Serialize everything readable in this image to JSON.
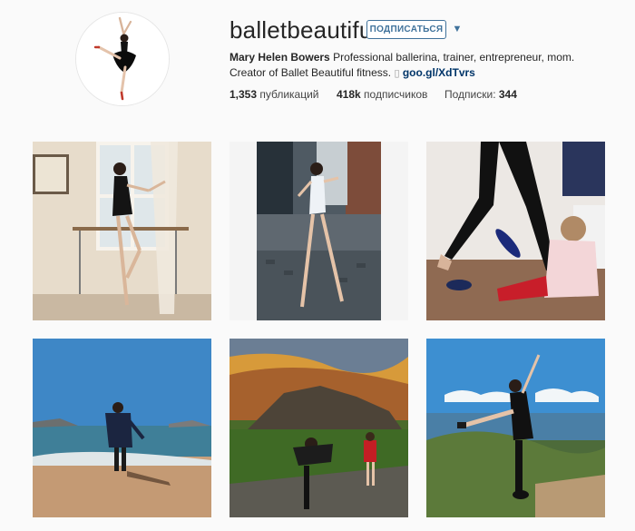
{
  "profile": {
    "username": "balletbeautiful",
    "follow_label": "ПОДПИСАТЬСЯ",
    "more_glyph": "▼",
    "full_name": "Mary Helen Bowers",
    "bio_text": "Professional ballerina, trainer, entrepreneur, mom. Creator of Ballet Beautiful fitness.",
    "link_glyph": "▯",
    "link": "goo.gl/XdTvrs",
    "stats": {
      "posts_count": "1,353",
      "posts_label": "публикаций",
      "followers_count": "418k",
      "followers_label": "подписчиков",
      "following_label": "Подписки:",
      "following_count": "344"
    }
  },
  "colors": {
    "accent": "#3f729b",
    "link": "#003569",
    "background": "#fafafa"
  },
  "posts": [
    {
      "description": "ballerina at barre by window"
    },
    {
      "description": "ballerina on city street"
    },
    {
      "description": "ballet legs with toddler"
    },
    {
      "description": "dancer on beach"
    },
    {
      "description": "dancer and child at sunset rocks"
    },
    {
      "description": "dancer in arabesque on coast"
    }
  ]
}
